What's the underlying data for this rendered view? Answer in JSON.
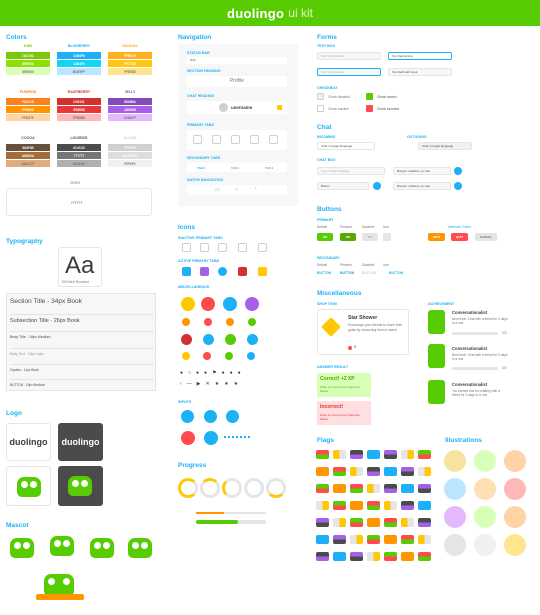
{
  "header": {
    "brand": "duolingo",
    "subtitle": "ui kit"
  },
  "colors": {
    "title": "Colors",
    "groups": [
      {
        "name": "KIWI",
        "shades": [
          "7AC70C",
          "8EE000",
          "8EE000"
        ],
        "colors": [
          "#7ac70c",
          "#8ee000",
          "#d7ffb8"
        ]
      },
      {
        "name": "BLUEBERRY",
        "shades": [
          "1CB0F6",
          "14D4F4",
          "BCE5FF"
        ],
        "colors": [
          "#1cb0f6",
          "#14d4f4",
          "#bce5ff"
        ]
      },
      {
        "name": "BANANA",
        "shades": [
          "FFB020",
          "FFC715",
          "FFE58D"
        ],
        "colors": [
          "#ffb020",
          "#ffc715",
          "#ffe58d"
        ]
      },
      {
        "name": "PUMPKIN",
        "shades": [
          "FA811B",
          "FF9600",
          "FFD37F"
        ],
        "colors": [
          "#fa811b",
          "#ff9600",
          "#ffd3a5"
        ]
      },
      {
        "name": "RASPBERRY",
        "shades": [
          "D33131",
          "E53838",
          "FFB8B8"
        ],
        "colors": [
          "#d33131",
          "#e53838",
          "#ffb8b8"
        ]
      },
      {
        "name": "JELLY",
        "shades": [
          "8549BA",
          "A560E8",
          "E4BAFF"
        ],
        "colors": [
          "#8549ba",
          "#a560e8",
          "#e4baff"
        ]
      },
      {
        "name": "COCOA",
        "shades": [
          "664F3B",
          "A66D3A",
          "DEAC7F"
        ],
        "colors": [
          "#664f3b",
          "#a66d3a",
          "#deac7f"
        ]
      },
      {
        "name": "LICORICE",
        "shades": [
          "4C4C4C",
          "777777",
          "AFAFAF"
        ],
        "colors": [
          "#4c4c4c",
          "#777777",
          "#afafaf"
        ]
      },
      {
        "name": "CLOUD",
        "shades": [
          "CFCFCF",
          "DDDDDD",
          "F0F0F0"
        ],
        "colors": [
          "#cfcfcf",
          "#dddddd",
          "#f0f0f0"
        ]
      }
    ],
    "grid_label": "GRIDS",
    "grid_value": "FFFFFF"
  },
  "typography": {
    "title": "Typography",
    "sample": "Aa",
    "font_name": "DIN Next Rounded",
    "styles": [
      "Section Title - 34px Book",
      "Subsection Title - 26px Book",
      "Body Title - 18px Medium",
      "Body Text - 18px Light",
      "Caption - 11px Book",
      "BUTTON - 15px Medium"
    ]
  },
  "logo": {
    "title": "Logo",
    "word": "duolingo"
  },
  "mascot": {
    "title": "Mascot"
  },
  "navigation": {
    "title": "Navigation",
    "status_bar": "STATUS BAR",
    "time": "9:41",
    "section_heading": "SECTION HEADING",
    "profile": "Profile",
    "chat_heading": "CHAT HEADING",
    "username": "username",
    "primary_tabs": "PRIMARY TABS",
    "secondary_tabs": "SECONDARY TABS",
    "tabs": [
      "TAB 1",
      "TAB 2",
      "TAB 3"
    ],
    "native_navigation": "NATIVE NAVIGATION"
  },
  "icons": {
    "title": "Icons",
    "inactive": "INACTIVE PRIMARY TABS",
    "active": "ACTIVE PRIMARY TABS",
    "misc": "MISCELLANEOUS",
    "inputs": "INPUTS"
  },
  "progress": {
    "title": "Progress"
  },
  "forms": {
    "title": "Forms",
    "textbox": "TEXT BOX",
    "fields": [
      "Text field inactive",
      "Text field active",
      "Text field focused",
      "Text field with input"
    ],
    "checkbox": "CHECKBOX",
    "checks": [
      "Check disabled",
      "Check correct",
      "Check inactive",
      "Check incorrect"
    ]
  },
  "chat": {
    "title": "Chat",
    "incoming": "INCOMING",
    "outgoing": "OUTGOING",
    "bubble": "Chat in target language",
    "chat_box": "CHAT BOX",
    "placeholder": "Type a chat message",
    "reply": "Bonjour madame, je vais",
    "button": "Button"
  },
  "buttons": {
    "title": "Buttons",
    "primary": "PRIMARY",
    "states": [
      "Default",
      "Pressed",
      "Disabled",
      "Icon"
    ],
    "ok": "OK",
    "alternate": "Alternate Colors",
    "alt": [
      "WAIT",
      "QUIT",
      "CANCEL"
    ],
    "secondary": "SECONDARY",
    "sec_label": "BUTTON"
  },
  "misc": {
    "title": "Miscellaneous",
    "shop_item": "SHOP ITEM",
    "shop_title": "Star Shower",
    "shop_text": "Encourage your friends to reach their goals by showering them in stars!",
    "shop_count": "5",
    "answer": "ANSWER RESULT",
    "correct": "Correct! +2 XP",
    "correct_sub": "Write or record your response below",
    "incorrect": "Incorrect!",
    "incorrect_sub": "Write or record your response below",
    "achievement": "ACHIEVEMENT",
    "ach_title": "Conversationalist",
    "ach_text1": "Next level: Chat with a friend for 3 days in a row",
    "ach_text2": "Next level: Chat with a friend for 5 days in a row",
    "ach_text3": "You earned this for chatting with a friend for 3 days in a row",
    "progress": "0/3"
  },
  "flags": {
    "title": "Flags"
  },
  "illustrations": {
    "title": "Illustrations"
  }
}
